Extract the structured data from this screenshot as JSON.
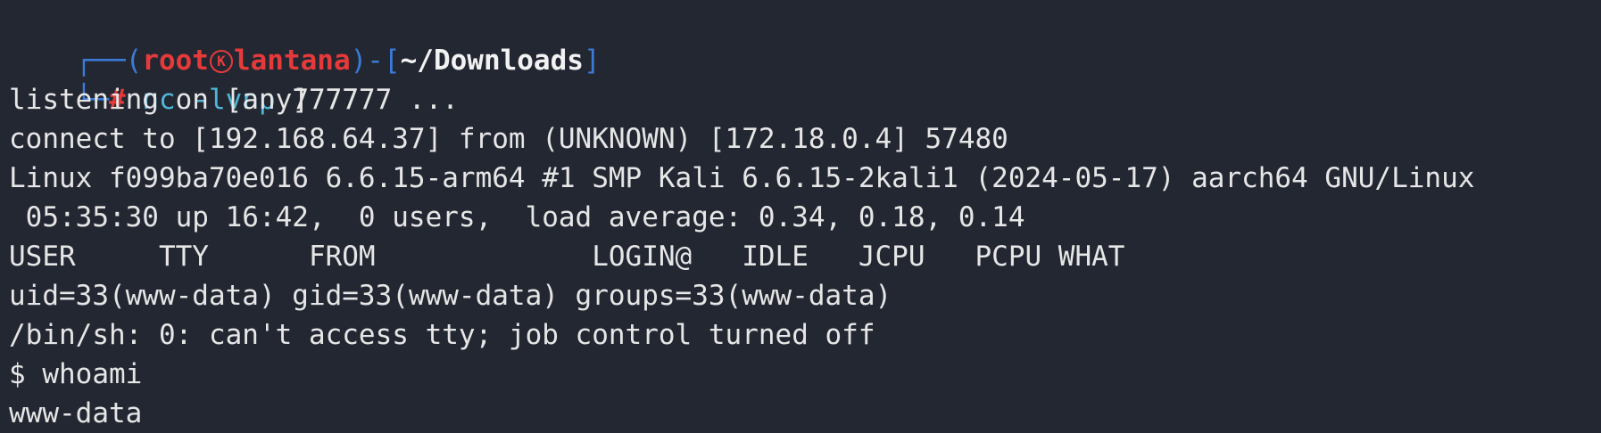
{
  "prompt": {
    "corner_top": "┌──(",
    "user": "root",
    "host": "lantana",
    "bracket_close_paren": ")",
    "dash_bracket_open": "-[",
    "path": "~/Downloads",
    "bracket_close": "]",
    "corner_bottom": "└─",
    "hash": "#",
    "command": "nc",
    "args": "-lvnp",
    "port": "7777",
    "skull_icon": "kali-skull-icon"
  },
  "output": [
    "listening on [any] 7777 ...",
    "connect to [192.168.64.37] from (UNKNOWN) [172.18.0.4] 57480",
    "Linux f099ba70e016 6.6.15-arm64 #1 SMP Kali 6.6.15-2kali1 (2024-05-17) aarch64 GNU/Linux",
    " 05:35:30 up 16:42,  0 users,  load average: 0.34, 0.18, 0.14",
    "USER     TTY      FROM             LOGIN@   IDLE   JCPU   PCPU WHAT",
    "uid=33(www-data) gid=33(www-data) groups=33(www-data)",
    "/bin/sh: 0: can't access tty; job control turned off",
    "$ whoami",
    "www-data"
  ],
  "colors": {
    "background": "#232732",
    "prompt_frame": "#3b7bd6",
    "root_user": "#e63a3a",
    "command": "#4fb6d8",
    "text": "#e6e6e6"
  }
}
